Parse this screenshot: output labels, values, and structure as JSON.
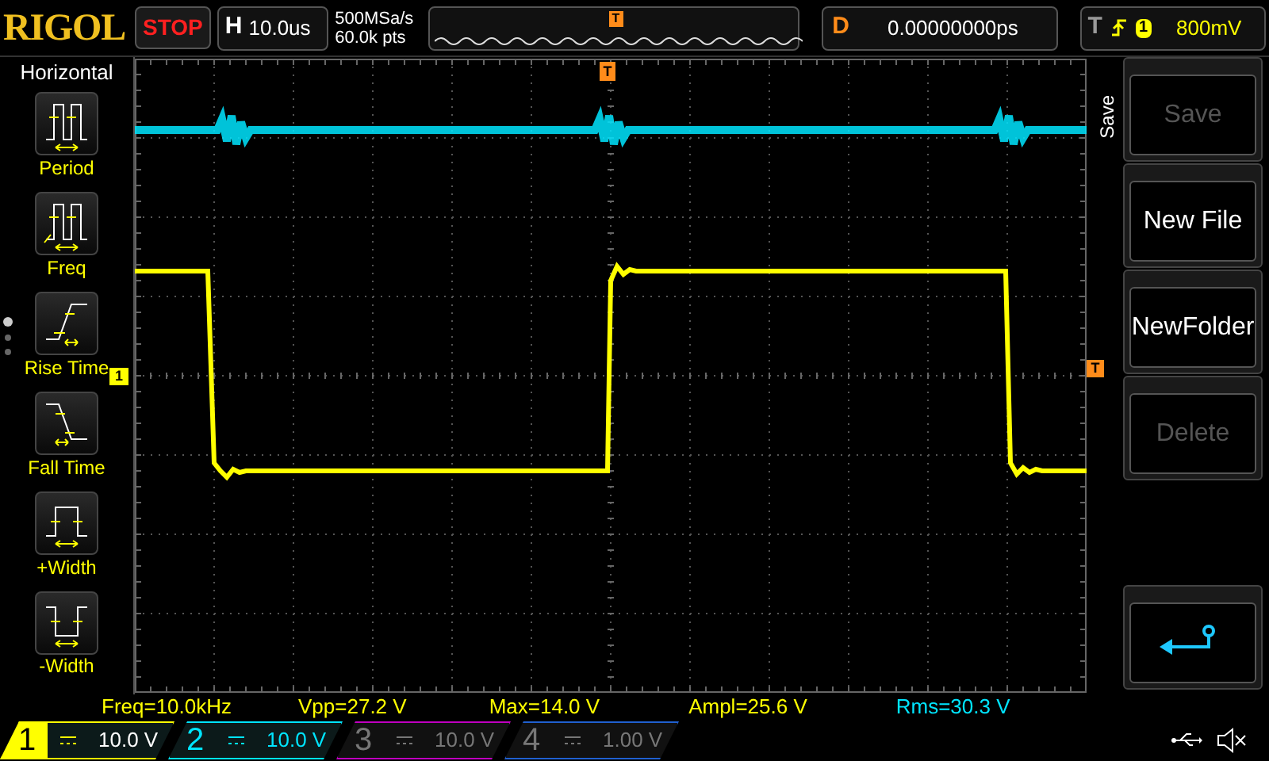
{
  "header": {
    "logo": "RIGOL",
    "run_state": "STOP",
    "timebase_label": "H",
    "timebase": "10.0us",
    "sample_rate": "500MSa/s",
    "memory_depth": "60.0k pts",
    "overview_trigger_marker": "T",
    "delay_label": "D",
    "delay": "0.00000000ps",
    "trigger_label": "T",
    "trigger_source": "1",
    "trigger_level": "800mV"
  },
  "left_menu": {
    "title": "Horizontal",
    "items": [
      {
        "label": "Period",
        "kind": "period"
      },
      {
        "label": "Freq",
        "kind": "freq"
      },
      {
        "label": "Rise Time",
        "kind": "rise"
      },
      {
        "label": "Fall Time",
        "kind": "fall"
      },
      {
        "label": "+Width",
        "kind": "pwidth"
      },
      {
        "label": "-Width",
        "kind": "nwidth"
      }
    ],
    "page_dots": [
      {
        "selected": true
      },
      {
        "selected": false
      },
      {
        "selected": false
      }
    ]
  },
  "grid": {
    "trigger_position_marker": "T",
    "trigger_level_marker": "T",
    "channel_marker": "1"
  },
  "measurements": [
    {
      "text": "Freq=10.0kHz",
      "color": "#ffff00"
    },
    {
      "text": "Vpp=27.2 V",
      "color": "#ffff00"
    },
    {
      "text": "Max=14.0 V",
      "color": "#ffff00"
    },
    {
      "text": "Ampl=25.6 V",
      "color": "#ffff00"
    },
    {
      "text": "Rms=30.3 V",
      "color": "#00e5ff"
    }
  ],
  "channels": [
    {
      "number": "1",
      "scale": "10.0 V",
      "enabled": true,
      "selected": true,
      "color": "#ffff00"
    },
    {
      "number": "2",
      "scale": "10.0 V",
      "enabled": true,
      "selected": false,
      "color": "#00e5ff"
    },
    {
      "number": "3",
      "scale": "10.0 V",
      "enabled": false,
      "selected": false,
      "color": "#c000c0"
    },
    {
      "number": "4",
      "scale": "1.00 V",
      "enabled": false,
      "selected": false,
      "color": "#2060d0"
    }
  ],
  "right_menu": {
    "title": "Save",
    "buttons": [
      {
        "kind": "text",
        "label": "Save",
        "disabled": true
      },
      {
        "kind": "text",
        "label": "New File",
        "disabled": false
      },
      {
        "kind": "text",
        "label": "NewFolder",
        "disabled": false
      },
      {
        "kind": "text",
        "label": "Delete",
        "disabled": true
      },
      {
        "kind": "spacer"
      },
      {
        "kind": "back",
        "disabled": false
      }
    ]
  }
}
